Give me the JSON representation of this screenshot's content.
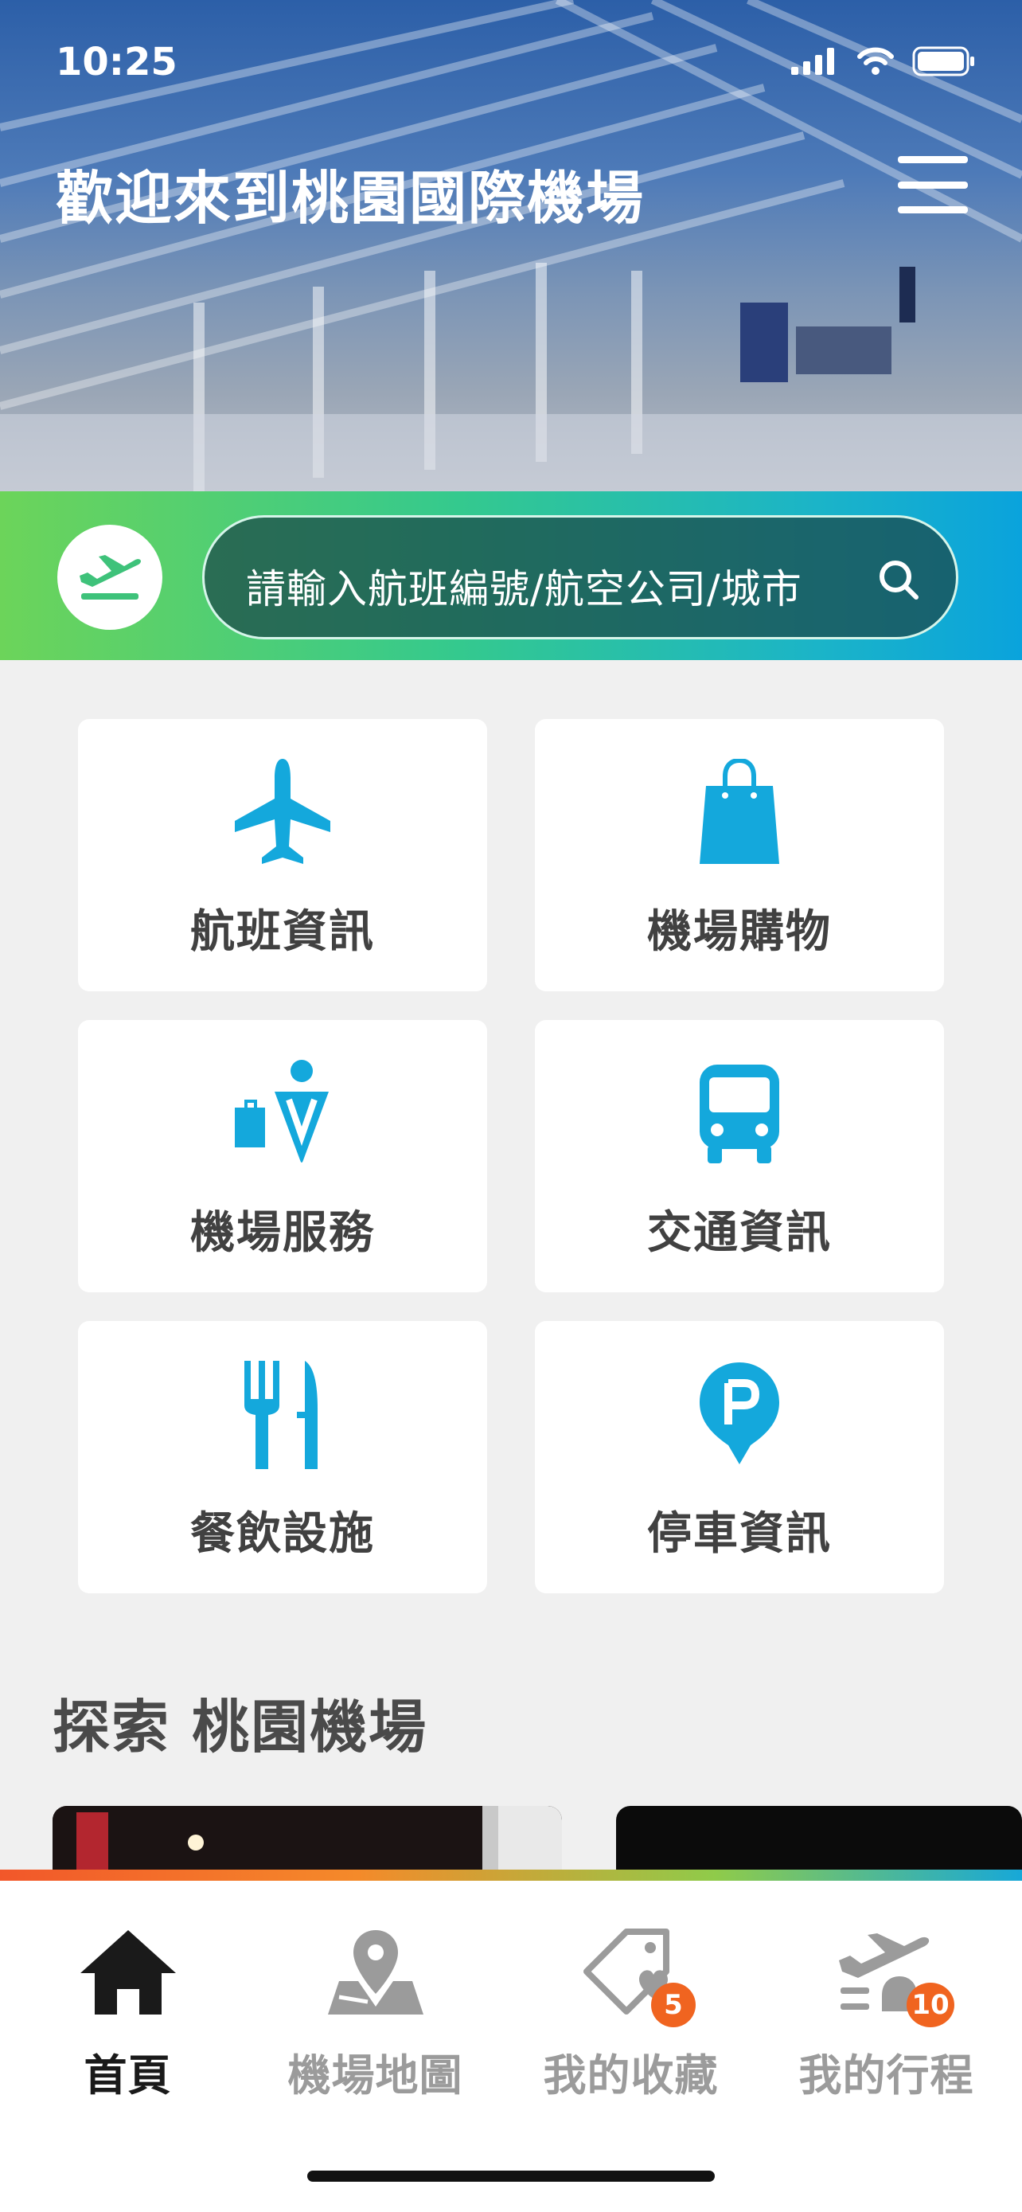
{
  "status_bar": {
    "time": "10:25"
  },
  "header": {
    "title": "歡迎來到桃園國際機場",
    "menu_icon": "hamburger-menu-icon"
  },
  "search": {
    "placeholder": "請輸入航班編號/航空公司/城市",
    "icon": "search-icon",
    "flight_icon": "plane-takeoff-icon"
  },
  "tiles": [
    {
      "label": "航班資訊",
      "icon": "airplane-icon"
    },
    {
      "label": "機場購物",
      "icon": "shopping-bag-icon"
    },
    {
      "label": "機場服務",
      "icon": "info-service-icon"
    },
    {
      "label": "交通資訊",
      "icon": "bus-icon"
    },
    {
      "label": "餐飲設施",
      "icon": "fork-knife-icon"
    },
    {
      "label": "停車資訊",
      "icon": "parking-pin-icon"
    }
  ],
  "explore": {
    "title": "探索 桃園機場"
  },
  "tabbar": {
    "items": [
      {
        "label": "首頁",
        "icon": "home-icon",
        "active": true
      },
      {
        "label": "機場地圖",
        "icon": "map-pin-icon",
        "active": false
      },
      {
        "label": "我的收藏",
        "icon": "heart-tag-icon",
        "active": false,
        "badge": "5"
      },
      {
        "label": "我的行程",
        "icon": "plane-bell-icon",
        "active": false,
        "badge": "10"
      }
    ]
  },
  "colors": {
    "accent_blue": "#14a8dc",
    "badge_orange": "#f06420",
    "tile_text": "#414141"
  }
}
